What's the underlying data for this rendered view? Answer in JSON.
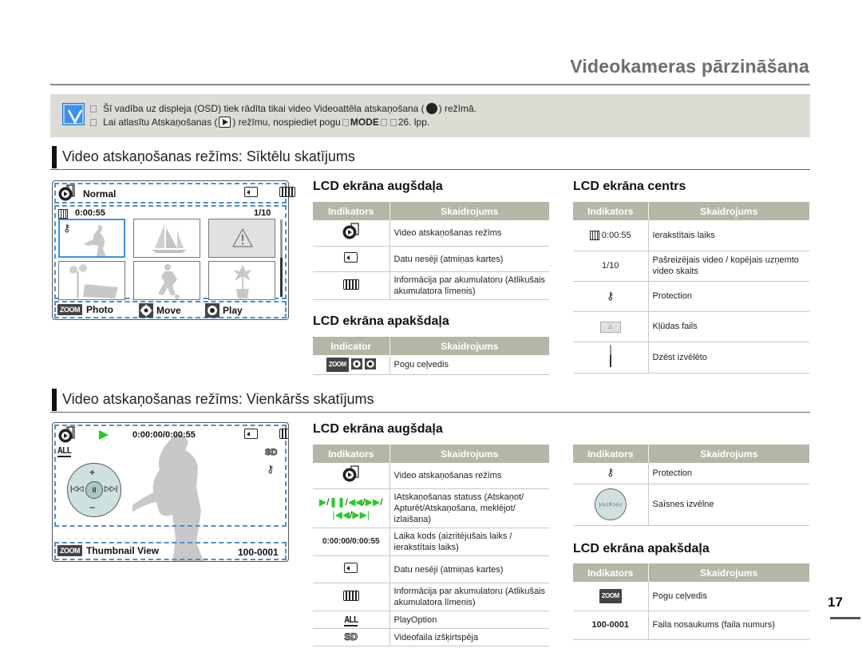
{
  "header": {
    "title": "Videokameras pārzināšana"
  },
  "note": {
    "icon": "checkmark-note-icon",
    "lines": [
      {
        "before": "Šī vadība uz displeja (OSD) tiek rādīta tikai video Videoattēla atskaņošana (",
        "icon": "video-play-mode-icon",
        "after": ") režīmā."
      },
      {
        "before": "Lai atlasītu Atskaņošanas (",
        "icon": "play-button-icon",
        "after": ") režīmu, nospiediet pogu",
        "bold": "MODE",
        "tail": " 26. lpp."
      }
    ]
  },
  "section1": {
    "title": "Video atskaņošanas režīms: Sīktēlu skatījums",
    "lcd": {
      "mode_label": "Normal",
      "time": "0:00:55",
      "counter": "1/10",
      "thumbnails": [
        {
          "name": "person-dancing",
          "selected": true,
          "protected": true
        },
        {
          "name": "sailboat"
        },
        {
          "name": "error-file",
          "error": true
        },
        {
          "name": "park-bench"
        },
        {
          "name": "soccer-player"
        },
        {
          "name": "potted-plant"
        }
      ],
      "footer": [
        {
          "icon": "zoom-badge",
          "badge": "ZOOM",
          "label": "Photo"
        },
        {
          "icon": "joystick-move-icon",
          "label": "Move"
        },
        {
          "icon": "joystick-play-icon",
          "label": "Play"
        }
      ]
    },
    "top_table": {
      "title": "LCD ekrāna augšdaļa",
      "headers": [
        "Indikators",
        "Skaidrojums"
      ],
      "rows": [
        {
          "icon": "video-play-mode-icon",
          "desc": "Video atskaņošanas režīms"
        },
        {
          "icon": "memory-card-icon",
          "desc": "Datu nesēji (atmiņas kartes)"
        },
        {
          "icon": "battery-icon",
          "desc": "Informācija par akumulatoru (Atlikušais akumulatora līmenis)"
        }
      ]
    },
    "bottom_table": {
      "title": "LCD ekrāna apakšdaļa",
      "headers": [
        "Indicator",
        "Skaidrojums"
      ],
      "rows": [
        {
          "icon": "zoom-joystick-icons",
          "badge": "ZOOM",
          "desc": "Pogu ceļvedis"
        }
      ]
    },
    "center_table": {
      "title": "LCD ekrāna centrs",
      "headers": [
        "Indikators",
        "Skaidrojums"
      ],
      "rows": [
        {
          "icon": "film-icon",
          "text": "0:00:55",
          "desc": "Ierakstītais laiks"
        },
        {
          "text": "1/10",
          "desc": "Pašreizējais video / kopējais uzņemto video skaits"
        },
        {
          "icon": "key-icon",
          "desc": "Protection"
        },
        {
          "icon": "error-thumbnail-icon",
          "desc": "Kļūdas fails"
        },
        {
          "icon": "scrollbar-icon",
          "desc": "Dzēst izvēlēto"
        }
      ]
    }
  },
  "section2": {
    "title": "Video atskaņošanas režīms: Vienkāršs skatījums",
    "lcd": {
      "timecode": "0:00:00/0:00:55",
      "resolution": "SD",
      "footer_badge": "ZOOM",
      "footer_label": "Thumbnail View",
      "file_number": "100-0001"
    },
    "top_table": {
      "title": "LCD ekrāna augšdaļa",
      "headers": [
        "Indikators",
        "Skaidrojums"
      ],
      "rows": [
        {
          "icon": "video-play-mode-icon",
          "desc": "Video atskaņošanas režīms"
        },
        {
          "icon": "playback-status-icons",
          "desc": "IAtskaņošanas statuss (Atskaņot/ Apturēt/Atskaņošana, meklējot/ izlaišana)"
        },
        {
          "text": "0:00:00/0:00:55",
          "desc": "Laika kods (aizritējušais laiks / ierakstītais laiks)"
        },
        {
          "icon": "memory-card-icon",
          "desc": "Datu nesēji (atmiņas kartes)"
        },
        {
          "icon": "battery-icon",
          "desc": "Informācija par akumulatoru (Atlikušais akumulatora līmenis)"
        },
        {
          "icon": "play-option-all-icon",
          "desc": "PlayOption"
        },
        {
          "icon": "sd-resolution-icon",
          "text": "SD",
          "desc": "Videofaila izšķirtspēja"
        }
      ]
    },
    "right_table": {
      "headers": [
        "Indikators",
        "Skaidrojums"
      ],
      "rows": [
        {
          "icon": "key-icon",
          "desc": "Protection"
        },
        {
          "icon": "shortcut-dial-icon",
          "desc": "Saīsnes izvēlne"
        }
      ]
    },
    "bottom_table": {
      "title": "LCD ekrāna apakšdaļa",
      "headers": [
        "Indikators",
        "Skaidrojums"
      ],
      "rows": [
        {
          "icon": "zoom-badge",
          "badge": "ZOOM",
          "desc": "Pogu ceļvedis"
        },
        {
          "text": "100-0001",
          "desc": "Faila nosaukums (faila numurs)"
        }
      ]
    }
  },
  "page_number": "17",
  "colors": {
    "accent_blue": "#3b8ff0",
    "table_header": "#b6b6a6",
    "note_bg": "#dcdcd4",
    "play_green": "#22cc22"
  }
}
